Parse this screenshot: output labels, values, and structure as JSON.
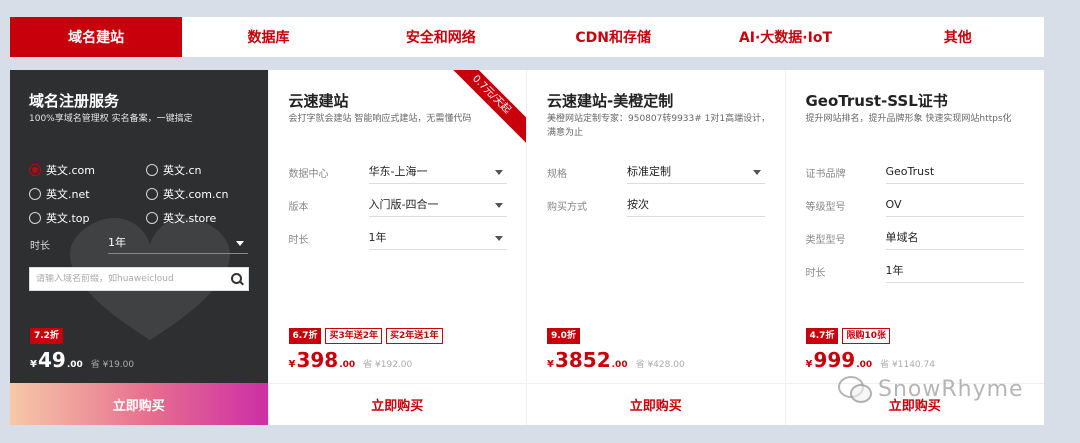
{
  "tabs": [
    {
      "label": "域名建站",
      "active": true
    },
    {
      "label": "数据库",
      "active": false
    },
    {
      "label": "安全和网络",
      "active": false
    },
    {
      "label": "CDN和存储",
      "active": false
    },
    {
      "label": "AI·大数据·IoT",
      "active": false
    },
    {
      "label": "其他",
      "active": false
    }
  ],
  "domain_card": {
    "title": "域名注册服务",
    "subtitle": "100%享域名管理权 实名备案，一键搞定",
    "options": [
      {
        "label": "英文.com",
        "checked": true
      },
      {
        "label": "英文.cn",
        "checked": false
      },
      {
        "label": "英文.net",
        "checked": false
      },
      {
        "label": "英文.com.cn",
        "checked": false
      },
      {
        "label": "英文.top",
        "checked": false
      },
      {
        "label": "英文.store",
        "checked": false
      }
    ],
    "duration_label": "时长",
    "duration_value": "1年",
    "search_placeholder": "请输入域名前缀，如huaweicloud",
    "badges": [
      "7.2折"
    ],
    "price": {
      "currency": "¥",
      "int": "49",
      "dec": ".00",
      "original": "省 ¥19.00"
    },
    "buy_label": "立即购买"
  },
  "site_card": {
    "title": "云速建站",
    "subtitle": "会打字就会建站 智能响应式建站，无需懂代码",
    "ribbon": "0.7元/天起",
    "rows": [
      {
        "label": "数据中心",
        "value": "华东-上海一"
      },
      {
        "label": "版本",
        "value": "入门版-四合一"
      },
      {
        "label": "时长",
        "value": "1年"
      }
    ],
    "badges": [
      "6.7折",
      "买3年送2年",
      "买2年送1年"
    ],
    "price": {
      "currency": "¥",
      "int": "398",
      "dec": ".00",
      "original": "省 ¥192.00"
    },
    "buy_label": "立即购买"
  },
  "custom_card": {
    "title": "云速建站-美橙定制",
    "subtitle": "美橙网站定制专家：950807转9933# 1对1高端设计，满意为止",
    "rows": [
      {
        "label": "规格",
        "value": "标准定制"
      },
      {
        "label": "购买方式",
        "value": "按次"
      }
    ],
    "badges": [
      "9.0折"
    ],
    "price": {
      "currency": "¥",
      "int": "3852",
      "dec": ".00",
      "original": "省 ¥428.00"
    },
    "buy_label": "立即购买"
  },
  "ssl_card": {
    "title": "GeoTrust-SSL证书",
    "subtitle": "提升网站排名，提升品牌形象 快速实现网站https化",
    "rows": [
      {
        "label": "证书品牌",
        "value": "GeoTrust"
      },
      {
        "label": "等级型号",
        "value": "OV"
      },
      {
        "label": "类型型号",
        "value": "单域名"
      },
      {
        "label": "时长",
        "value": "1年"
      }
    ],
    "badges": [
      "4.7折",
      "限购10张"
    ],
    "price": {
      "currency": "¥",
      "int": "999",
      "dec": ".00",
      "original": "省 ¥1140.74"
    },
    "buy_label": "立即购买"
  },
  "watermark": "SnowRhyme",
  "colors": {
    "brand_red": "#c7000b",
    "dark_card": "#2e2f31",
    "page_bg": "#d7dee8"
  }
}
